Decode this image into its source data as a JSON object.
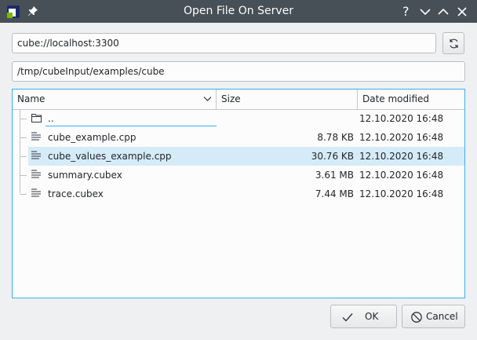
{
  "window": {
    "title": "Open File On Server",
    "help_glyph": "?"
  },
  "server_field": {
    "value": "cube://localhost:3300"
  },
  "path_field": {
    "value": "/tmp/cubeInput/examples/cube"
  },
  "columns": [
    "Name",
    "Size",
    "Date modified"
  ],
  "files": [
    {
      "name": "..",
      "size": "",
      "date": "12.10.2020 16:48",
      "icon": "folder-icon"
    },
    {
      "name": "cube_example.cpp",
      "size": "8.78 KB",
      "date": "12.10.2020 16:48",
      "icon": "text-file-icon"
    },
    {
      "name": "cube_values_example.cpp",
      "size": "30.76 KB",
      "date": "12.10.2020 16:48",
      "icon": "text-file-icon",
      "selected": true
    },
    {
      "name": "summary.cubex",
      "size": "3.61 MB",
      "date": "12.10.2020 16:48",
      "icon": "text-file-icon"
    },
    {
      "name": "trace.cubex",
      "size": "7.44 MB",
      "date": "12.10.2020 16:48",
      "icon": "text-file-icon"
    }
  ],
  "buttons": {
    "ok": "OK",
    "cancel": "Cancel"
  },
  "colors": {
    "titlebar": "#475057",
    "accent": "#3daee9",
    "selection": "#d6ebf8",
    "background": "#eff0f1"
  }
}
